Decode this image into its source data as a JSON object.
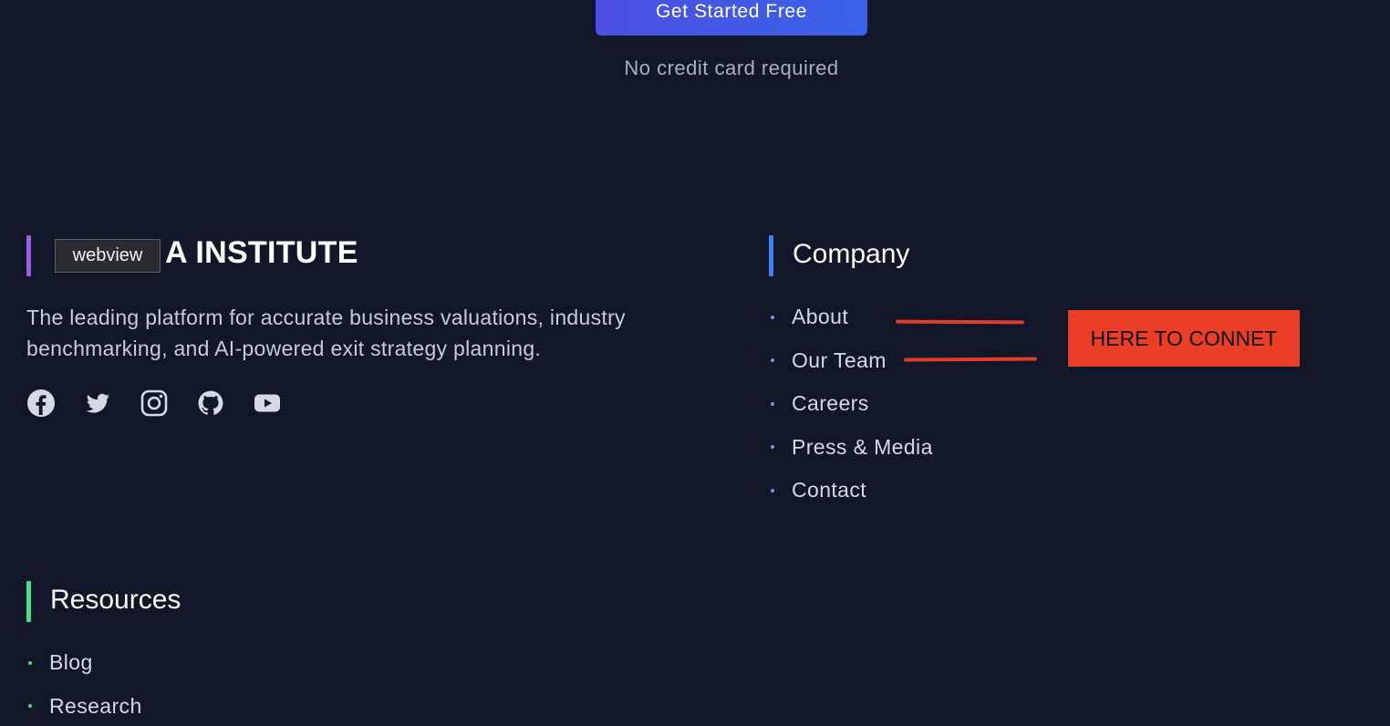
{
  "cta": {
    "button_label": "Get Started Free",
    "note": "No credit card required"
  },
  "brand": {
    "title_visible": "A INSTITUTE",
    "description": "The leading platform for accurate business valuations, industry benchmarking, and AI-powered exit strategy planning.",
    "tooltip": "webview",
    "accent_color": "#9b5de5",
    "social_icons": [
      "facebook-icon",
      "twitter-icon",
      "instagram-icon",
      "github-icon",
      "youtube-icon"
    ]
  },
  "company": {
    "title": "Company",
    "accent_color": "#3b82f6",
    "links": [
      "About",
      "Our Team",
      "Careers",
      "Press & Media",
      "Contact"
    ]
  },
  "resources": {
    "title": "Resources",
    "accent_color": "#4ade80",
    "links": [
      "Blog",
      "Research"
    ]
  },
  "annotation": {
    "label": "HERE TO CONNET",
    "color": "#ea3e26"
  }
}
